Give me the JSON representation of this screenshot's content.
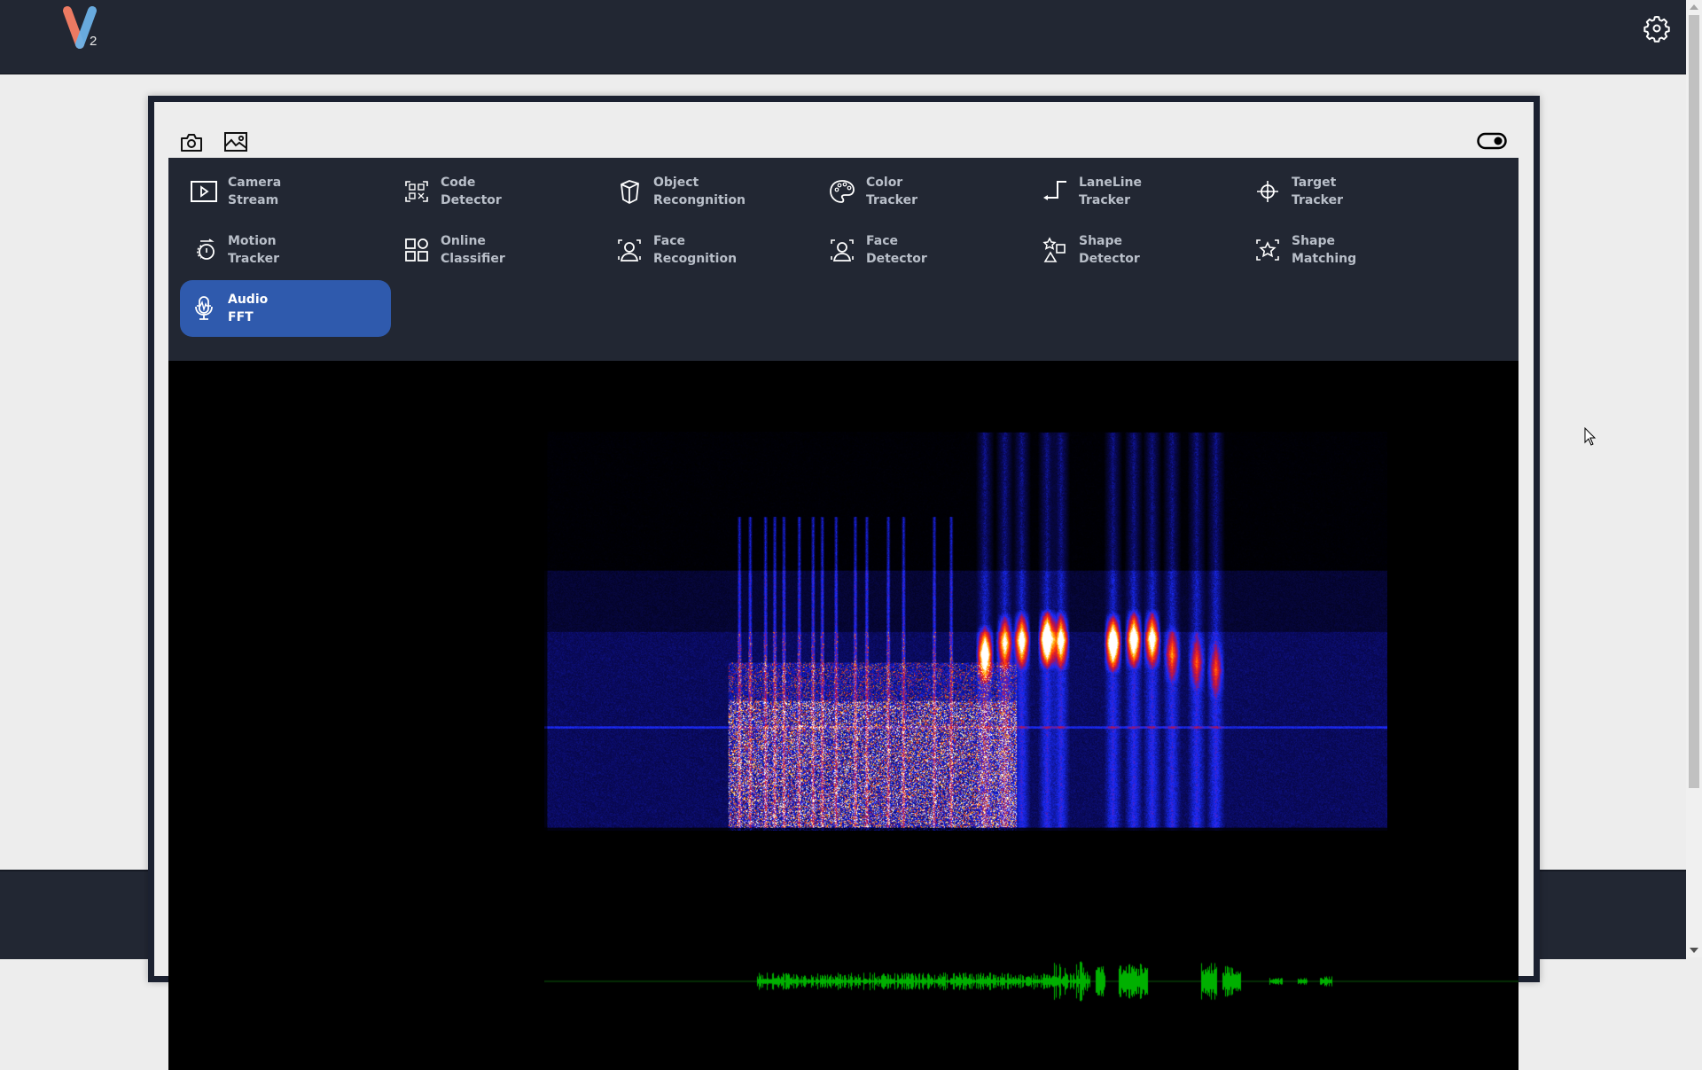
{
  "app": {
    "logo_letter": "V",
    "logo_subscript": "2",
    "brand_colors": {
      "logo_left": "#ec7a62",
      "logo_right": "#6cb2e8",
      "topbar": "#222733",
      "accent": "#2f5aad"
    }
  },
  "header": {
    "settings_icon": "gear-icon"
  },
  "toolbar": {
    "left_icons": [
      "camera-icon",
      "image-icon"
    ],
    "right_icon": "toggle-icon",
    "toggle_on": true
  },
  "menu": {
    "items": [
      {
        "line1": "Camera",
        "line2": "Stream",
        "icon": "play-screen-icon",
        "active": false
      },
      {
        "line1": "Code",
        "line2": "Detector",
        "icon": "qr-code-icon",
        "active": false
      },
      {
        "line1": "Object",
        "line2": "Recongnition",
        "icon": "cube-icon",
        "active": false
      },
      {
        "line1": "Color",
        "line2": "Tracker",
        "icon": "palette-icon",
        "active": false
      },
      {
        "line1": "LaneLine",
        "line2": "Tracker",
        "icon": "lane-line-icon",
        "active": false
      },
      {
        "line1": "Target",
        "line2": "Tracker",
        "icon": "crosshair-icon",
        "active": false
      },
      {
        "line1": "Motion",
        "line2": "Tracker",
        "icon": "motion-icon",
        "active": false
      },
      {
        "line1": "Online",
        "line2": "Classifier",
        "icon": "grid-classifier-icon",
        "active": false
      },
      {
        "line1": "Face",
        "line2": "Recognition",
        "icon": "face-recognition-icon",
        "active": false
      },
      {
        "line1": "Face",
        "line2": "Detector",
        "icon": "face-detector-icon",
        "active": false
      },
      {
        "line1": "Shape",
        "line2": "Detector",
        "icon": "shapes-icon",
        "active": false
      },
      {
        "line1": "Shape",
        "line2": "Matching",
        "icon": "star-frame-icon",
        "active": false
      },
      {
        "line1": "Audio",
        "line2": "FFT",
        "icon": "microphone-icon",
        "active": true
      }
    ]
  },
  "viewer": {
    "mode": "Audio FFT",
    "spectrogram_colormap": [
      "#000000",
      "#0a0a60",
      "#1a2cff",
      "#b01050",
      "#ff3010",
      "#ffb000",
      "#ffffff"
    ],
    "waveform_color": "#00b000"
  }
}
